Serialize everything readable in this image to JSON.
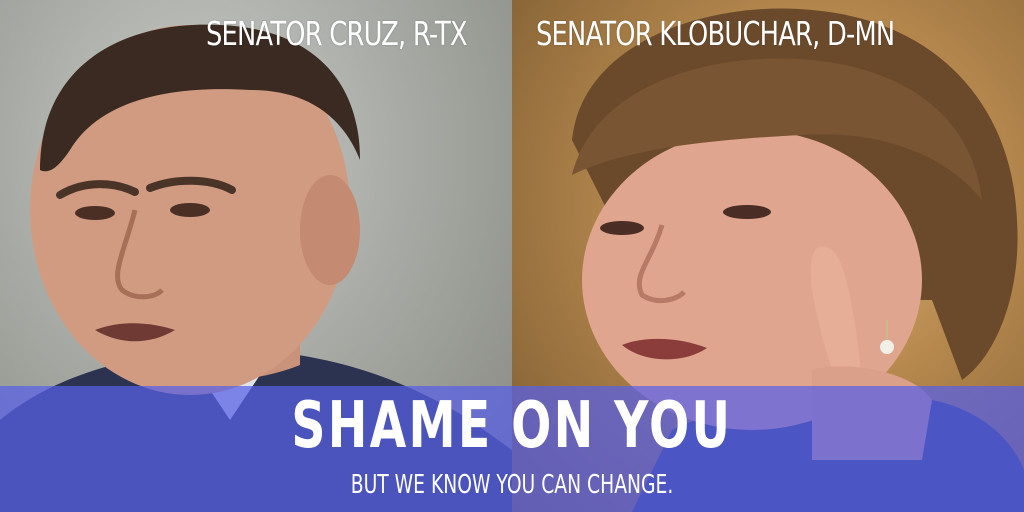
{
  "left_panel": {
    "label": "SENATOR CRUZ, R-TX"
  },
  "right_panel": {
    "label": "SENATOR KLOBUCHAR, D-MN"
  },
  "banner": {
    "headline": "SHAME ON YOU",
    "subline": "BUT WE KNOW YOU CAN CHANGE.",
    "color": "#5860e8"
  }
}
